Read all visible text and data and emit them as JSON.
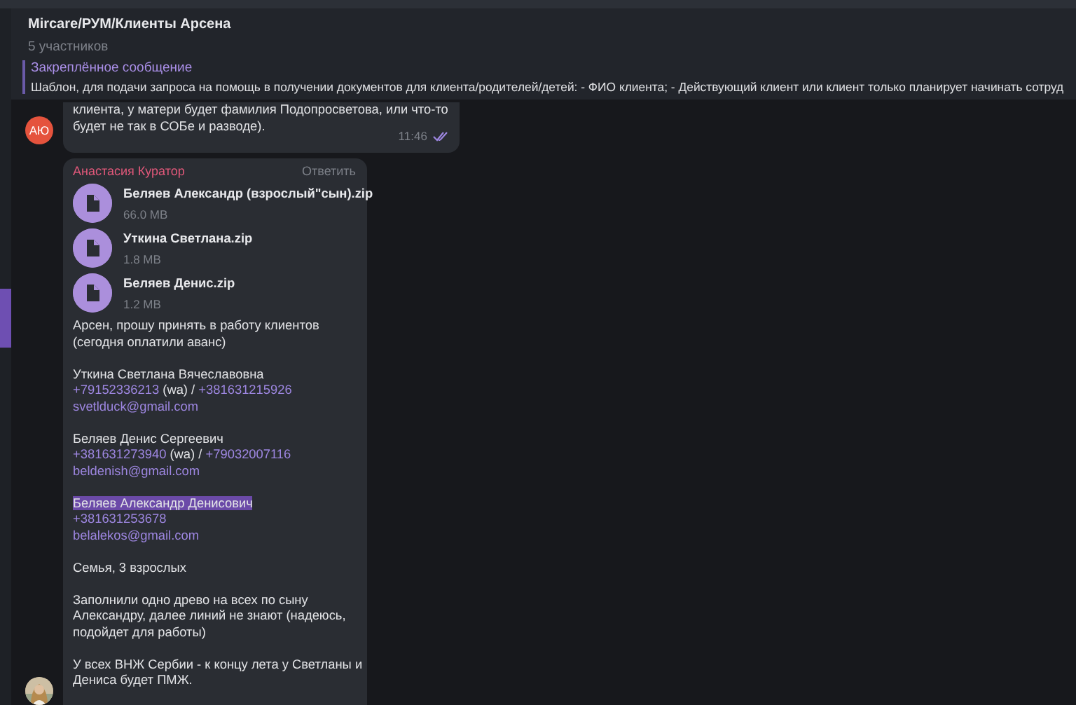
{
  "chat": {
    "title": "Mircare/РУМ/Клиенты Арсена",
    "subtitle": "5 участников"
  },
  "pinned": {
    "label": "Закреплённое сообщение",
    "text": "Шаблон, для подачи запроса на помощь в получении документов для клиента/родителей/детей: - ФИО клиента; - Действующий клиент или клиент только планирует начинать сотруд"
  },
  "messages": [
    {
      "kind": "text",
      "avatar": "АЮ",
      "lines": [
        "клиента, у матери будет фамилия Подопросветова, или что-то",
        "будет не так в СОБе и разводе)."
      ],
      "time": "11:46",
      "read": true
    },
    {
      "kind": "files",
      "sender": "Анастасия Куратор",
      "reply": "Ответить",
      "avatar": {
        "kind": "picture"
      },
      "files": [
        {
          "name": "Беляев Александр (взрослый\"сын).zip",
          "size": "66.0 MB"
        },
        {
          "name": "Уткина Светлана.zip",
          "size": "1.8 MB"
        },
        {
          "name": "Беляев Денис.zip",
          "size": "1.2 MB"
        }
      ],
      "paragraphs": [
        [
          [
            {
              "kind": "text",
              "text": "Арсен, прошу принять в работу клиентов"
            }
          ],
          [
            {
              "kind": "text",
              "text": "(сегодня оплатили аванс)"
            }
          ]
        ],
        [
          [
            {
              "kind": "text",
              "text": "Уткина Светлана Вячеславовна"
            }
          ],
          [
            {
              "kind": "link",
              "text": "+79152336213"
            },
            {
              "kind": "text",
              "text": " (wa) / "
            },
            {
              "kind": "link",
              "text": "+381631215926"
            }
          ],
          [
            {
              "kind": "link",
              "text": "svetlduck@gmail.com"
            }
          ]
        ],
        [
          [
            {
              "kind": "text",
              "text": "Беляев Денис Сергеевич"
            }
          ],
          [
            {
              "kind": "link",
              "text": "+381631273940"
            },
            {
              "kind": "text",
              "text": " (wa) / "
            },
            {
              "kind": "link",
              "text": "+79032007116"
            }
          ],
          [
            {
              "kind": "link",
              "text": "beldenish@gmail.com"
            }
          ]
        ],
        [
          [
            {
              "kind": "selected",
              "text": "Беляев Александр Денисович"
            }
          ],
          [
            {
              "kind": "link",
              "text": "+381631253678"
            }
          ],
          [
            {
              "kind": "link",
              "text": "belalekos@gmail.com"
            }
          ]
        ],
        [
          [
            {
              "kind": "text",
              "text": "Семья, 3 взрослых"
            }
          ]
        ],
        [
          [
            {
              "kind": "text",
              "text": "Заполнили одно древо на всех по сыну"
            }
          ],
          [
            {
              "kind": "text",
              "text": "Александру, далее линий не знают (надеюсь,"
            }
          ],
          [
            {
              "kind": "text",
              "text": "подойдет для работы)"
            }
          ]
        ],
        [
          [
            {
              "kind": "text",
              "text": "У всех ВНЖ Сербии - к концу лета у Светланы и"
            }
          ],
          [
            {
              "kind": "text",
              "text": "Дениса будет ПМЖ."
            }
          ]
        ]
      ]
    }
  ]
}
